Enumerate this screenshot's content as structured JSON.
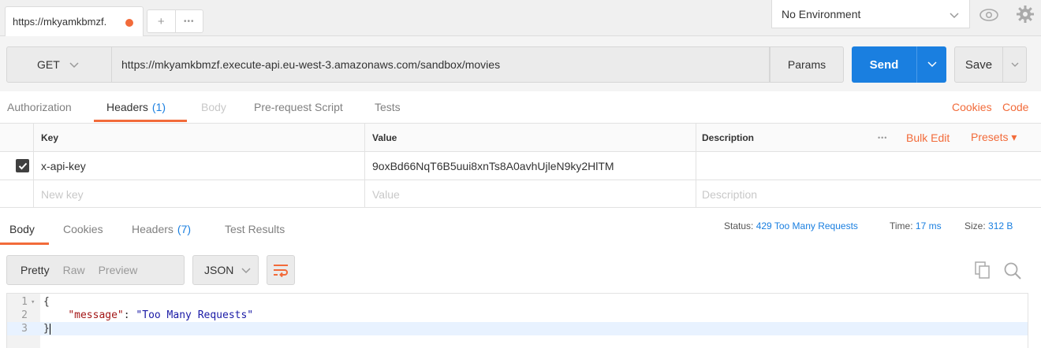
{
  "topbar": {
    "tab_title": "https://mkyamkbmzf.",
    "tab_title_display": "https://mkyamkbmzf.",
    "add_tab": "+",
    "more_tabs": "•••",
    "environment": "No Environment"
  },
  "request": {
    "method": "GET",
    "url": "https://mkyamkbmzf.execute-api.eu-west-3.amazonaws.com/sandbox/movies",
    "params_label": "Params",
    "send_label": "Send",
    "save_label": "Save"
  },
  "request_tabs": {
    "authorization": "Authorization",
    "headers": "Headers",
    "headers_count": "(1)",
    "body": "Body",
    "prerequest": "Pre-request Script",
    "tests": "Tests",
    "cookies": "Cookies",
    "code": "Code"
  },
  "headers_table": {
    "columns": {
      "key": "Key",
      "value": "Value",
      "description": "Description"
    },
    "more": "•••",
    "bulk_edit": "Bulk Edit",
    "presets": "Presets ▾",
    "rows": [
      {
        "key": "x-api-key",
        "value": "9oxBd66NqT6B5uui8xnTs8A0avhUjleN9ky2HlTM",
        "description": "",
        "checked": true
      }
    ],
    "placeholder": {
      "key": "New key",
      "value": "Value",
      "description": "Description"
    }
  },
  "response_tabs": {
    "body": "Body",
    "cookies": "Cookies",
    "headers": "Headers",
    "headers_count": "(7)",
    "test_results": "Test Results",
    "status_label": "Status:",
    "status_value": "429 Too Many Requests",
    "time_label": "Time:",
    "time_value": "17 ms",
    "size_label": "Size:",
    "size_value": "312 B"
  },
  "body_toolbar": {
    "pretty": "Pretty",
    "raw": "Raw",
    "preview": "Preview",
    "format": "JSON"
  },
  "response_body": {
    "lines": [
      {
        "num": "1",
        "text": "{"
      },
      {
        "num": "2",
        "key": "\"message\"",
        "sep": ": ",
        "value": "\"Too Many Requests\""
      },
      {
        "num": "3",
        "text": "}"
      }
    ]
  },
  "colors": {
    "accent_orange": "#f26b3a",
    "send_blue": "#1a7fe0",
    "link_blue": "#1a7fe0"
  }
}
